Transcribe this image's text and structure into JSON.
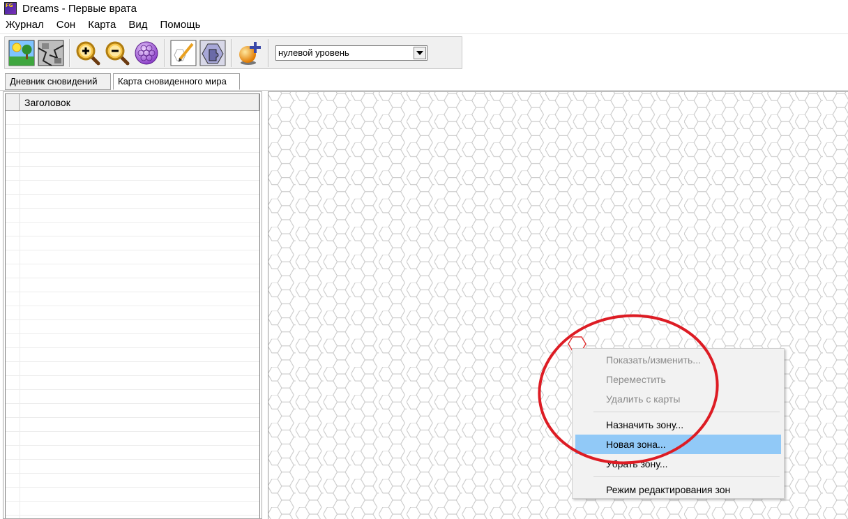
{
  "window": {
    "title": "Dreams - Первые врата",
    "icon": "fg-app-icon"
  },
  "menu": [
    "Журнал",
    "Сон",
    "Карта",
    "Вид",
    "Помощь"
  ],
  "toolbar": {
    "buttons": [
      {
        "name": "landscape-icon"
      },
      {
        "name": "broken-image-icon"
      },
      {
        "name": "zoom-in-icon"
      },
      {
        "name": "zoom-out-icon"
      },
      {
        "name": "hex-grid-icon"
      },
      {
        "name": "edit-hex-icon"
      },
      {
        "name": "puzzle-hex-icon"
      },
      {
        "name": "add-sphere-icon"
      }
    ],
    "level_select": {
      "value": "нулевой уровень"
    }
  },
  "tabs": [
    {
      "label": "Дневник сновидений",
      "active": false
    },
    {
      "label": "Карта сновиденного мира",
      "active": true
    }
  ],
  "list": {
    "column_header": "Заголовок"
  },
  "context_menu": {
    "items": [
      {
        "label": "Показать/изменить...",
        "disabled": true
      },
      {
        "label": "Переместить",
        "disabled": true
      },
      {
        "label": "Удалить с карты",
        "disabled": true
      },
      {
        "label": "Назначить зону...",
        "disabled": false
      },
      {
        "label": "Новая зона...",
        "disabled": false,
        "highlighted": true
      },
      {
        "label": "Убрать зону...",
        "disabled": false
      },
      {
        "label": "Режим редактирования зон",
        "disabled": false
      }
    ]
  },
  "colors": {
    "grid_line": "#c4c4c4",
    "selected_hex": "#e03030",
    "annotation": "#dd1c24",
    "highlight": "#91c9f7"
  }
}
